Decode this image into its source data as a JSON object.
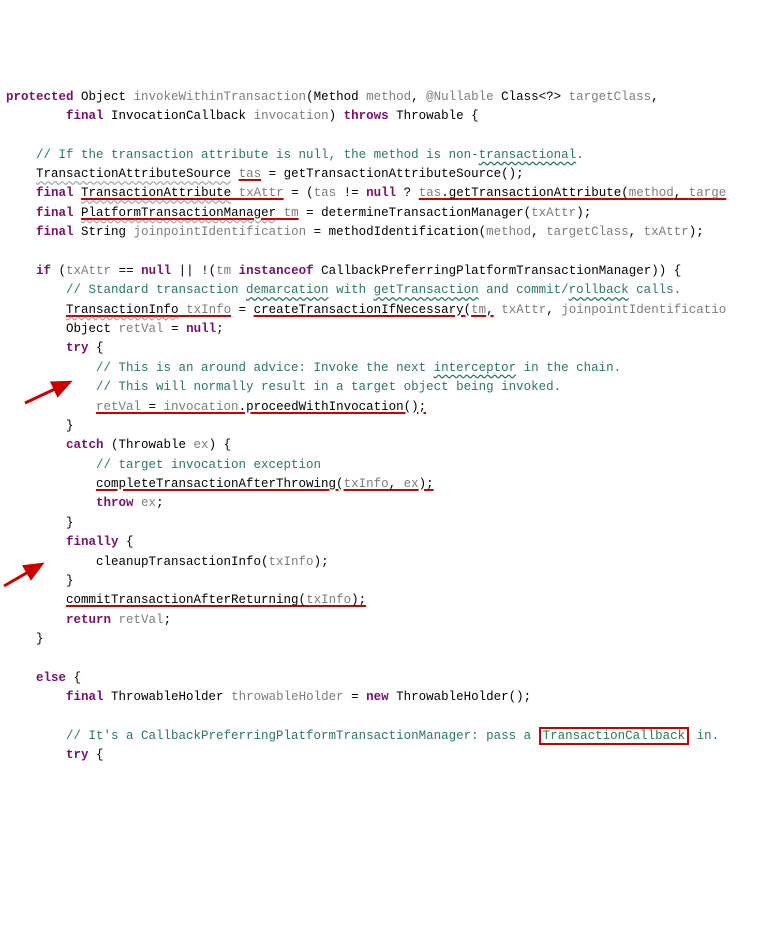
{
  "code": {
    "l1_a": "protected",
    "l1_b": " Object ",
    "l1_c": "invokeWithinTransaction",
    "l1_d": "(Method ",
    "l1_e": "method",
    "l1_f": ", ",
    "l1_g": "@Nullable",
    "l1_h": " Class<?> ",
    "l1_i": "targetClass",
    "l1_j": ",",
    "l2_a": "final",
    "l2_b": " InvocationCallback ",
    "l2_c": "invocation",
    "l2_d": ") ",
    "l2_e": "throws",
    "l2_f": " Throwable {",
    "l3": "",
    "l4_a": "// If the transaction attribute is null, the method is non-",
    "l4_b": "transactional",
    "l4_c": ".",
    "l5_a": "TransactionAttributeSource",
    "l5_b": " ",
    "l5_c": "tas",
    "l5_d": " = getTransactionAttributeSource();",
    "l6_a": "final",
    "l6_b": " ",
    "l6_c": "TransactionAttribute",
    "l6_d": " ",
    "l6_e": "txAttr",
    "l6_f": " = (",
    "l6_g": "tas",
    "l6_h": " != ",
    "l6_i": "null",
    "l6_j": " ? ",
    "l6_k": "tas",
    "l6_l": ".getTransactionAttribute(",
    "l6_m": "method",
    "l6_n": ", ",
    "l6_o": "targe",
    "l7_a": "final",
    "l7_b": " ",
    "l7_c": "PlatformTransactionManager",
    "l7_d": " ",
    "l7_e": "tm",
    "l7_f": " = determineTransactionManager(",
    "l7_g": "txAttr",
    "l7_h": ");",
    "l8_a": "final",
    "l8_b": " String ",
    "l8_c": "joinpointIdentification",
    "l8_d": " = methodIdentification(",
    "l8_e": "method",
    "l8_f": ", ",
    "l8_g": "targetClass",
    "l8_h": ", ",
    "l8_i": "txAttr",
    "l8_j": ");",
    "l9": "",
    "l10_a": "if",
    "l10_b": " (",
    "l10_c": "txAttr",
    "l10_d": " == ",
    "l10_e": "null",
    "l10_f": " || !(",
    "l10_g": "tm",
    "l10_h": " ",
    "l10_i": "instanceof",
    "l10_j": " CallbackPreferringPlatformTransactionManager)) {",
    "l11_a": "// Standard transaction ",
    "l11_b": "demarcation",
    "l11_c": " with ",
    "l11_d": "getTransaction",
    "l11_e": " and commit/",
    "l11_f": "rollback",
    "l11_g": " calls.",
    "l12_a": "TransactionInfo",
    "l12_b": " ",
    "l12_c": "txInfo",
    "l12_d": " = ",
    "l12_e": "createTransactionIfNecessary(",
    "l12_f": "tm",
    "l12_g": ",",
    "l12_h": " ",
    "l12_i": "txAttr",
    "l12_j": ", ",
    "l12_k": "joinpointIdentificatio",
    "l13_a": "Object ",
    "l13_b": "retVal",
    "l13_c": " = ",
    "l13_d": "null",
    "l13_e": ";",
    "l14_a": "try",
    "l14_b": " {",
    "l15_a": "// This is an around advice: Invoke the next ",
    "l15_b": "interceptor",
    "l15_c": " in the chain.",
    "l16": "// This will normally result in a target object being invoked.",
    "l17_a": "retVal",
    "l17_b": " = ",
    "l17_c": "invocation",
    "l17_d": ".proceedWithInvocation();",
    "l18": "}",
    "l19_a": "catch",
    "l19_b": " (Throwable ",
    "l19_c": "ex",
    "l19_d": ") {",
    "l20": "// target invocation exception",
    "l21_a": "completeTransactionAfterThrowing(",
    "l21_b": "txInfo",
    "l21_c": ", ",
    "l21_d": "ex",
    "l21_e": ");",
    "l22_a": "throw",
    "l22_b": " ",
    "l22_c": "ex",
    "l22_d": ";",
    "l23": "}",
    "l24_a": "finally",
    "l24_b": " {",
    "l25_a": "cleanupTransactionInfo(",
    "l25_b": "txInfo",
    "l25_c": ");",
    "l26": "}",
    "l27_a": "commitTransactionAfterReturning(",
    "l27_b": "txInfo",
    "l27_c": ");",
    "l28_a": "return",
    "l28_b": " ",
    "l28_c": "retVal",
    "l28_d": ";",
    "l29": "}",
    "l30": "",
    "l31_a": "else",
    "l31_b": " {",
    "l32_a": "final",
    "l32_b": " ThrowableHolder ",
    "l32_c": "throwableHolder",
    "l32_d": " = ",
    "l32_e": "new",
    "l32_f": " ThrowableHolder();",
    "l33": "",
    "l34_a": "// It's a CallbackPreferringPlatformTransactionManager: pass a ",
    "l34_b": "TransactionCallback",
    "l34_c": " in.",
    "l35_a": "try",
    "l35_b": " {"
  }
}
